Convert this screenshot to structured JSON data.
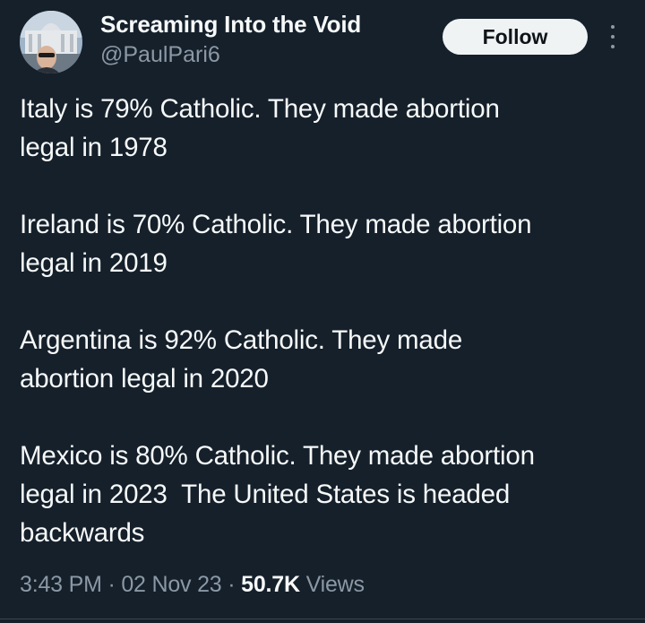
{
  "author": {
    "display_name": "Screaming Into the Void",
    "handle": "@PaulPari6",
    "avatar_icon": "profile-photo"
  },
  "actions": {
    "follow_label": "Follow",
    "more_icon": "more-vertical-icon"
  },
  "tweet": {
    "paragraphs": [
      "Italy is 79% Catholic. They made abortion\nlegal in 1978",
      "Ireland is 70% Catholic. They made abortion\nlegal in 2019",
      "Argentina is 92% Catholic. They made\nabortion legal in 2020",
      "Mexico is 80% Catholic. They made abortion\nlegal in 2023  The United States is headed\nbackwards"
    ]
  },
  "meta": {
    "time": "3:43 PM",
    "separator": " · ",
    "date": "02 Nov 23",
    "views_count": "50.7K",
    "views_label": " Views"
  },
  "colors": {
    "background": "#15202b",
    "primary_text": "#f7f9f9",
    "secondary_text": "#8b98a5",
    "follow_button_bg": "#eff3f4"
  }
}
